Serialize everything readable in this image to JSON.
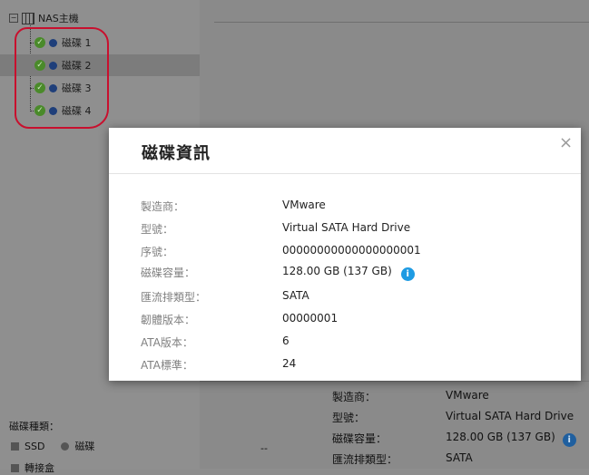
{
  "tree": {
    "root_label": "NAS主機",
    "items": [
      {
        "label": "磁碟 1",
        "selected": false
      },
      {
        "label": "磁碟 2",
        "selected": true
      },
      {
        "label": "磁碟 3",
        "selected": false
      },
      {
        "label": "磁碟 4",
        "selected": false
      }
    ]
  },
  "legend": {
    "title": "磁碟種類：",
    "ssd": "SSD",
    "disk": "磁碟",
    "partial": "轉接盒"
  },
  "background_details": {
    "dash": "--",
    "rows": [
      {
        "key": "製造商：",
        "value": "VMware"
      },
      {
        "key": "型號：",
        "value": "Virtual SATA Hard Drive"
      },
      {
        "key": "磁碟容量：",
        "value": "128.00 GB (137 GB)"
      },
      {
        "key": "匯流排類型：",
        "value": "SATA"
      }
    ]
  },
  "modal": {
    "title": "磁碟資訊",
    "close_symbol": "×",
    "info_symbol": "i",
    "rows": [
      {
        "key": "製造商：",
        "value": "VMware"
      },
      {
        "key": "型號：",
        "value": "Virtual SATA Hard Drive"
      },
      {
        "key": "序號：",
        "value": "00000000000000000001"
      },
      {
        "key": "磁碟容量：",
        "value": "128.00 GB (137 GB)"
      },
      {
        "key": "匯流排類型：",
        "value": "SATA"
      },
      {
        "key": "韌體版本：",
        "value": "00000001"
      },
      {
        "key": "ATA版本：",
        "value": "6"
      },
      {
        "key": "ATA標準：",
        "value": "24"
      }
    ]
  },
  "colors": {
    "annotation_red": "#c8102e",
    "info_blue": "#1e9be3",
    "healthy_green": "#4a8a2a"
  }
}
